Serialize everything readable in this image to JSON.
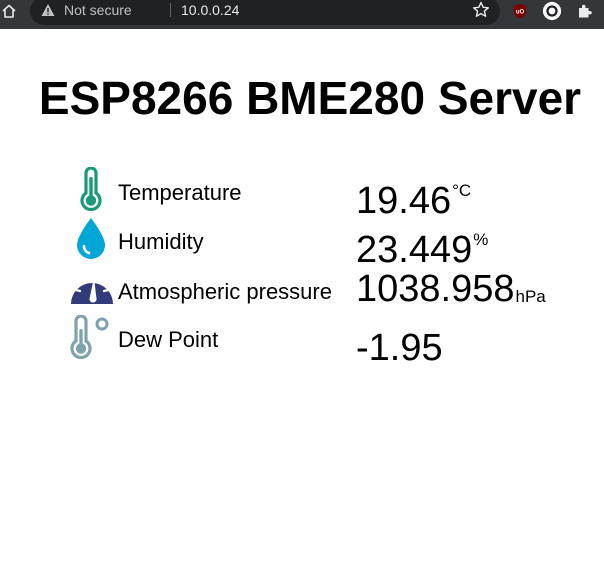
{
  "browser": {
    "security_label": "Not secure",
    "url": "10.0.0.24",
    "icons": [
      "home-icon",
      "warning-icon",
      "star-icon",
      "ublock-icon",
      "circle-extension-icon",
      "puzzle-icon"
    ]
  },
  "page": {
    "title": "ESP8266 BME280 Server"
  },
  "readings": [
    {
      "label": "Temperature",
      "value": "19.46",
      "unit": "°C",
      "icon": "thermometer-icon",
      "icon_color": "#1a9a78"
    },
    {
      "label": "Humidity",
      "value": "23.449",
      "unit": "%",
      "icon": "water-drop-icon",
      "icon_color": "#00a6d6"
    },
    {
      "label": "Atmospheric pressure",
      "value": "1038.958",
      "unit": "hPa",
      "icon": "gauge-icon",
      "icon_color": "#313a7a"
    },
    {
      "label": "Dew Point",
      "value": "-1.95",
      "unit": "",
      "icon": "dew-point-thermometer-icon",
      "icon_color": "#7fa3ad"
    }
  ]
}
